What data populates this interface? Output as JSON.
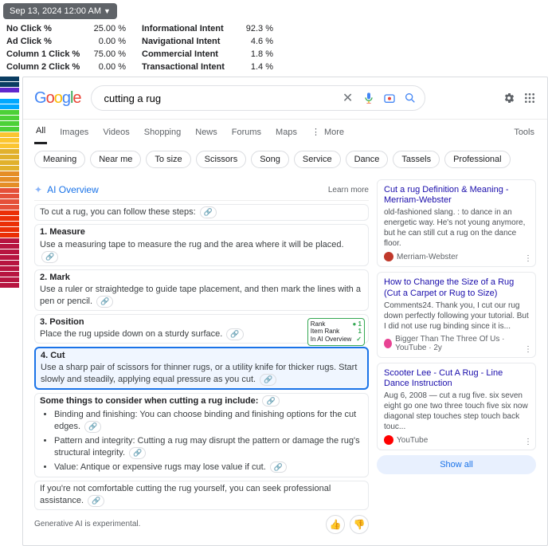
{
  "timestamp": "Sep 13, 2024 12:00 AM",
  "stats": {
    "left": [
      {
        "label": "No Click %",
        "value": "25.00 %"
      },
      {
        "label": "Ad Click %",
        "value": "0.00 %"
      },
      {
        "label": "Column 1 Click %",
        "value": "75.00 %"
      },
      {
        "label": "Column 2 Click %",
        "value": "0.00 %"
      }
    ],
    "right": [
      {
        "label": "Informational Intent",
        "value": "92.3 %"
      },
      {
        "label": "Navigational Intent",
        "value": "4.6 %"
      },
      {
        "label": "Commercial Intent",
        "value": "1.8 %"
      },
      {
        "label": "Transactional Intent",
        "value": "1.4 %"
      }
    ]
  },
  "color_strip": [
    "#0a3d62",
    "#0a3d62",
    "#5f27cd",
    "#fff",
    "#00a8ff",
    "#00a8ff",
    "#4cd137",
    "#4cd137",
    "#4cd137",
    "#4cd137",
    "#fbc531",
    "#fbc531",
    "#fbc531",
    "#e1b12c",
    "#e1b12c",
    "#e1b12c",
    "#e1b12c",
    "#e58e26",
    "#e58e26",
    "#e58e26",
    "#e55039",
    "#e55039",
    "#e55039",
    "#e55039",
    "#eb2f06",
    "#eb2f06",
    "#eb2f06",
    "#eb2f06",
    "#eb2f06",
    "#b71540",
    "#b71540",
    "#b71540",
    "#b71540",
    "#b71540",
    "#b71540",
    "#b71540",
    "#b71540",
    "#b71540"
  ],
  "search": {
    "query": "cutting a rug"
  },
  "tabs": [
    "All",
    "Images",
    "Videos",
    "Shopping",
    "News",
    "Forums",
    "Maps"
  ],
  "tabs_more": "More",
  "tabs_tools": "Tools",
  "chips": [
    "Meaning",
    "Near me",
    "To size",
    "Scissors",
    "Song",
    "Service",
    "Dance",
    "Tassels",
    "Professional"
  ],
  "ai": {
    "title": "AI Overview",
    "learn_more": "Learn more",
    "intro": "To cut a rug, you can follow these steps:",
    "steps": [
      {
        "num": "1.",
        "title": "Measure",
        "body": "Use a measuring tape to measure the rug and the area where it will be placed."
      },
      {
        "num": "2.",
        "title": "Mark",
        "body": "Use a ruler or straightedge to guide tape placement, and then mark the lines with a pen or pencil."
      },
      {
        "num": "3.",
        "title": "Position",
        "body": "Place the rug upside down on a sturdy surface."
      },
      {
        "num": "4.",
        "title": "Cut",
        "body": "Use a sharp pair of scissors for thinner rugs, or a utility knife for thicker rugs. Start slowly and steadily, applying equal pressure as you cut."
      }
    ],
    "rank_badge": {
      "r1": "Rank",
      "v1": "● 1",
      "r2": "Item Rank",
      "v2": "1",
      "r3": "In AI Overview",
      "v3": "✓"
    },
    "consider_title": "Some things to consider when cutting a rug include:",
    "bullets": [
      "Binding and finishing: You can choose binding and finishing options for the cut edges.",
      "Pattern and integrity: Cutting a rug may disrupt the pattern or damage the rug's structural integrity.",
      "Value: Antique or expensive rugs may lose value if cut."
    ],
    "outro": "If you're not comfortable cutting the rug yourself, you can seek professional assistance.",
    "footer": "Generative AI is experimental."
  },
  "refs": [
    {
      "title": "Cut a rug Definition & Meaning - Merriam-Webster",
      "desc": "old-fashioned slang. : to dance in an energetic way. He's not young anymore, but he can still cut a rug on the dance floor.",
      "source": "Merriam-Webster",
      "favcolor": "#c0392b"
    },
    {
      "title": "How to Change the Size of a Rug (Cut a Carpet or Rug to Size)",
      "desc": "Comments24. Thank you, I cut our rug down perfectly following your tutorial. But I did not use rug binding since it is...",
      "source": "Bigger Than The Three Of Us · YouTube · 2y",
      "favcolor": "#e84393"
    },
    {
      "title": "Scooter Lee - Cut A Rug - Line Dance Instruction",
      "desc": "Aug 6, 2008 — cut a rug five. six seven eight go one two three touch five six now diagonal step touches step touch back touc...",
      "source": "YouTube",
      "favcolor": "#ff0000"
    }
  ],
  "show_all": "Show all"
}
